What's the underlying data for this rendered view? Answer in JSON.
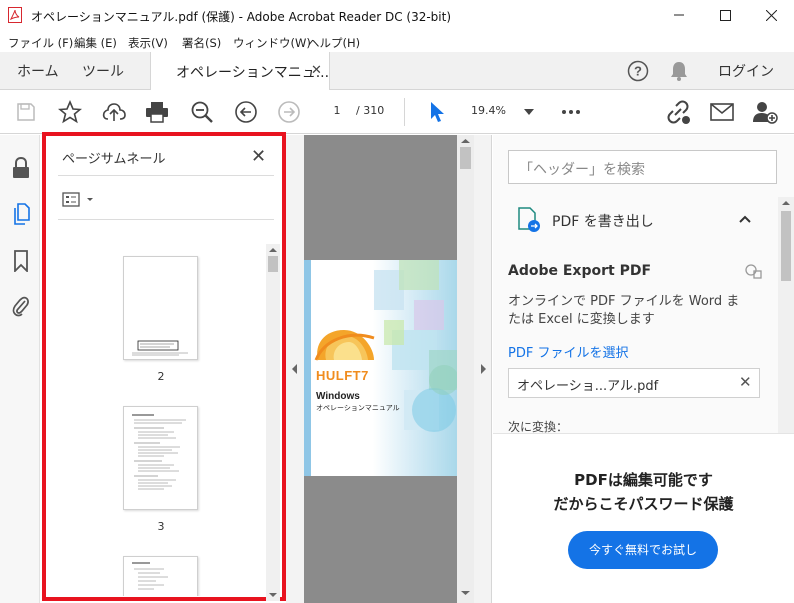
{
  "window": {
    "title": "オペレーションマニュアル.pdf (保護) - Adobe Acrobat Reader DC (32-bit)"
  },
  "menu": [
    "ファイル (F)",
    "編集 (E)",
    "表示(V)",
    "署名(S)",
    "ウィンドウ(W)",
    "ヘルプ(H)"
  ],
  "tabs": {
    "home": "ホーム",
    "tools": "ツール",
    "document": "オペレーションマニュ...",
    "login": "ログイン"
  },
  "toolbar": {
    "page_current": "1",
    "page_total": "/ 310",
    "zoom": "19.4%"
  },
  "thumbnails": {
    "title": "ページサムネール",
    "pages": [
      {
        "label": "2"
      },
      {
        "label": "3"
      }
    ]
  },
  "document_page": {
    "logo_text": "HULFT7",
    "platform": "Windows",
    "subtitle": "オペレーションマニュアル"
  },
  "right_panel": {
    "search_placeholder": "「ヘッダー」を検索",
    "export_section_title": "PDF を書き出し",
    "export_heading": "Adobe Export PDF",
    "export_description": "オンラインで PDF ファイルを Word または Excel に変換します",
    "select_file_link": "PDF ファイルを選択",
    "selected_file": "オペレーショ...アル.pdf",
    "convert_to_label": "次に変換：",
    "promo_line1": "PDFは編集可能です",
    "promo_line2": "だからこそパスワード保護",
    "promo_button": "今すぐ無料でお試し"
  },
  "colors": {
    "highlight_border": "#e8131f",
    "accent_blue": "#1473e6",
    "acrobat_red": "#d7282f"
  }
}
